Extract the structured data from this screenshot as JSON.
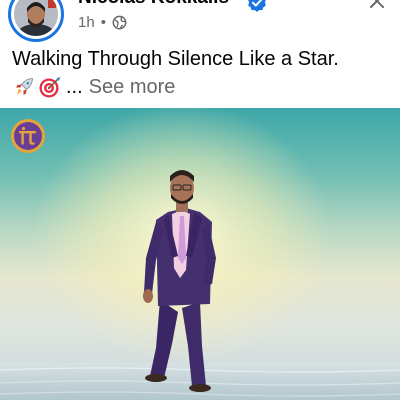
{
  "post": {
    "author_name": "Nicolas Kokkalis",
    "verified_icon": "verified-badge-icon",
    "time": "1h",
    "separator": "•",
    "audience_icon": "globe-icon",
    "close_icon": "close-icon",
    "caption_line1": "Walking Through Silence Like a Star.",
    "caption_emojis": [
      "rocket-emoji",
      "direct-hit-emoji"
    ],
    "ellipsis": "...",
    "see_more_label": "See more"
  },
  "image": {
    "badge_icon": "pi-network-logo",
    "colors": {
      "suit": "#3f2a6a",
      "shirt": "#f1d0e2",
      "tie": "#ce9ad8",
      "badge": "#e3a63a",
      "badge_inner": "#6b3e96"
    }
  },
  "colors": {
    "accent": "#1b74e4",
    "secondary_text": "#65676b",
    "primary_text": "#050505"
  }
}
